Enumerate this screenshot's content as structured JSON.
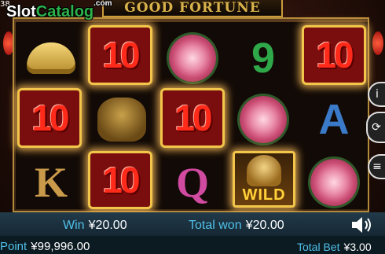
{
  "brand": {
    "logo_slot": "Slot",
    "logo_catalog": "Catalog",
    "logo_com": ".com",
    "corner": "38"
  },
  "game": {
    "title": "GOOD FORTUNE"
  },
  "reels": [
    [
      "ingot",
      "10",
      "10",
      "K"
    ],
    [
      "10",
      "toad",
      "10"
    ],
    [
      "flower",
      "10",
      "Q"
    ],
    [
      "9",
      "flower",
      "WILD"
    ],
    [
      "10",
      "A",
      "flower"
    ]
  ],
  "wild_label": "WILD",
  "footer": {
    "win_label": "Win",
    "win_value": "¥20.00",
    "total_won_label": "Total won",
    "total_won_value": "¥20.00",
    "point_label": "Point",
    "point_value": "¥99,996.00",
    "total_bet_label": "Total Bet",
    "total_bet_value": "¥3.00"
  },
  "icons": [
    "speaker-icon",
    "info-icon",
    "spin-icon",
    "menu-icon"
  ],
  "colors": {
    "accent_blue": "#4fc0e8",
    "gold": "#f1c64a",
    "red_ten": "#ff2a1a"
  }
}
